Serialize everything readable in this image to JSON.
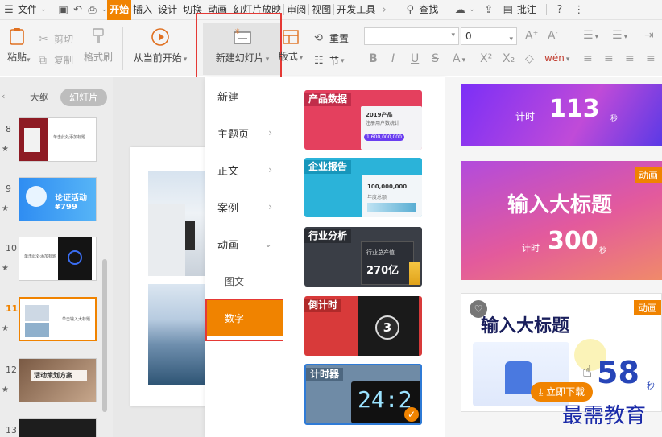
{
  "menubar": {
    "file_label": "文件",
    "tabs": [
      "开始",
      "插入",
      "设计",
      "切换",
      "动画",
      "幻灯片放映",
      "审阅",
      "视图",
      "开发工具"
    ],
    "search_label": "查找",
    "comment_label": "批注"
  },
  "ribbon": {
    "paste_label": "粘贴",
    "cut_label": "剪切",
    "copy_label": "复制",
    "format_painter_label": "格式刷",
    "from_current_label": "从当前开始",
    "new_slide_label": "新建幻灯片",
    "layout_label": "版式",
    "reset_label": "重置",
    "section_label": "节",
    "font_size_value": "0"
  },
  "left_panel": {
    "outline_tab": "大纲",
    "slides_tab": "幻灯片",
    "slides": [
      {
        "num": "8",
        "text": "单击此处添加标题"
      },
      {
        "num": "9",
        "text": "论证活动 ¥799"
      },
      {
        "num": "10",
        "text": "单击此处添加标题"
      },
      {
        "num": "11",
        "text": "单击输入大标题"
      },
      {
        "num": "12",
        "text": "活动策划方案"
      },
      {
        "num": "13",
        "text": ""
      }
    ]
  },
  "dropdown": {
    "menu": [
      {
        "label": "新建",
        "arrow": ""
      },
      {
        "label": "主题页",
        "arrow": "›"
      },
      {
        "label": "正文",
        "arrow": "›"
      },
      {
        "label": "案例",
        "arrow": "›"
      },
      {
        "label": "动画",
        "arrow": "⌄"
      },
      {
        "label": "图文",
        "arrow": ""
      },
      {
        "label": "数字",
        "arrow": ""
      }
    ],
    "cards": [
      {
        "tag": "产品数据",
        "line1": "2019产品",
        "line2": "注册用户数统计",
        "value": "1,600,000,000"
      },
      {
        "tag": "企业报告",
        "line1": "100,000,000",
        "line2": "年度总额"
      },
      {
        "tag": "行业分析",
        "line1": "行业总产值",
        "value": "270亿"
      },
      {
        "tag": "倒计时",
        "value": "3"
      },
      {
        "tag": "计时器",
        "value": "24:2"
      }
    ]
  },
  "right_panel": {
    "card1": {
      "prefix": "计时",
      "number": "113",
      "suffix": "秒"
    },
    "card2": {
      "title": "输入大标题",
      "prefix": "计时",
      "number": "300",
      "suffix": "秒",
      "badge": "动画"
    },
    "card3": {
      "title": "输入大标题",
      "number": "58",
      "suffix": "秒",
      "badge": "动画",
      "download_label": "立即下载"
    }
  },
  "watermark": "最需教育",
  "colors": {
    "accent": "#f08300",
    "highlight_box": "#e53935"
  }
}
